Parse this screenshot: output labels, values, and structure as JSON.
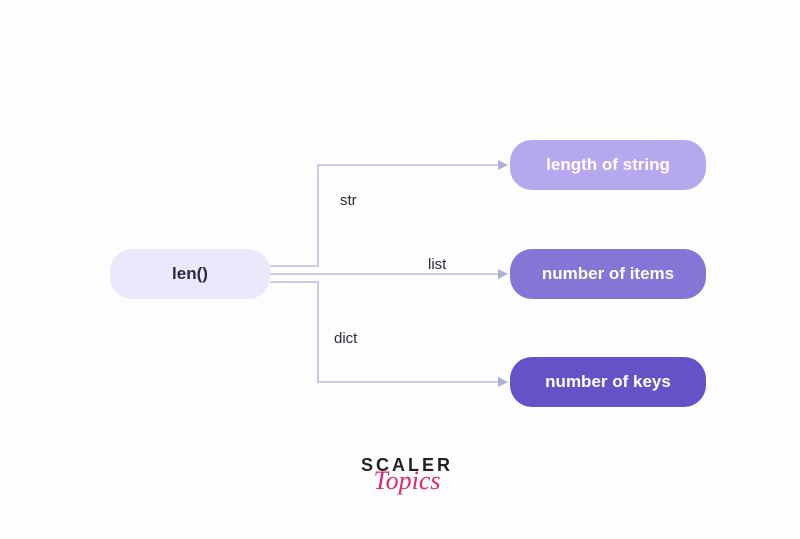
{
  "source": {
    "label": "len()"
  },
  "branches": [
    {
      "edge_label": "str",
      "output_label": "length of string"
    },
    {
      "edge_label": "list",
      "output_label": "number of items"
    },
    {
      "edge_label": "dict",
      "output_label": "number of keys"
    }
  ],
  "logo": {
    "line1": "SCALER",
    "line2": "Topics"
  },
  "chart_data": {
    "type": "diagram",
    "nodes": [
      {
        "id": "len",
        "label": "len()"
      },
      {
        "id": "str_out",
        "label": "length of string"
      },
      {
        "id": "list_out",
        "label": "number of items"
      },
      {
        "id": "dict_out",
        "label": "number of keys"
      }
    ],
    "edges": [
      {
        "from": "len",
        "to": "str_out",
        "label": "str"
      },
      {
        "from": "len",
        "to": "list_out",
        "label": "list"
      },
      {
        "from": "len",
        "to": "dict_out",
        "label": "dict"
      }
    ]
  }
}
